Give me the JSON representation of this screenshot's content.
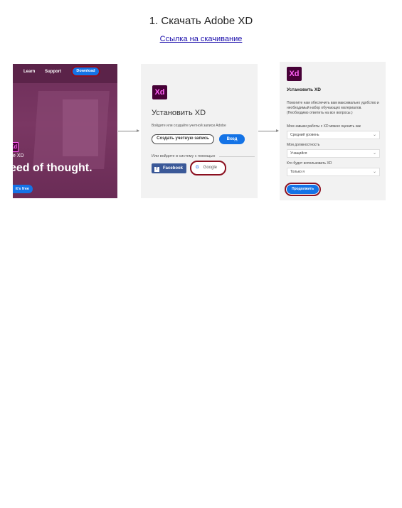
{
  "page": {
    "title": "1. Скачать Adobe XD",
    "download_link": "Ссылка на скачивание"
  },
  "panel1": {
    "nav": [
      "Learn",
      "Support"
    ],
    "download_label": "Download",
    "logo": "Xd",
    "subtitle": "e XD",
    "headline": "eed of thought.",
    "cta": "it's free",
    "accent_color": "#1473e6"
  },
  "panel2": {
    "logo": "Xd",
    "heading": "Установить XD",
    "description": "Войдите или создайте учетной записи Adobe",
    "create_account": "Создать учетную запись",
    "login": "Вход",
    "or_login_with": "Или войдите в систему с помощью",
    "facebook": "Facebook",
    "facebook_icon": "f",
    "google": "Google",
    "google_icon": "G"
  },
  "panel3": {
    "logo": "Xd",
    "heading": "Установить XD",
    "description": "Помогите нам обеспечить вам максимально удобство и необходимый набор обучающих материалов. (Необходимо ответить на все вопросы.)",
    "q1_label": "Мои навыки работы с XD можно оценить как",
    "q1_value": "Средний уровень",
    "q2_label": "Мои должностность",
    "q2_value": "Учащийся",
    "q3_label": "Кто будет использовать XD",
    "q3_value": "Только я",
    "continue": "Продолжить"
  },
  "colors": {
    "highlight_ring": "#8b0f1f",
    "xd_bg": "#470137",
    "xd_fg": "#ff61f6"
  }
}
